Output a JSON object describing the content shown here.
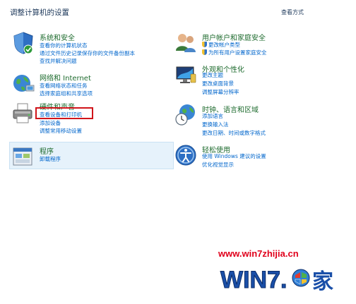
{
  "header": {
    "title": "调整计算机的设置",
    "view_by": "查看方式"
  },
  "categories": {
    "system_security": {
      "title": "系统和安全",
      "links": [
        "查看你的计算机状态",
        "通过文件历史记录保存你的文件备份副本",
        "查找并解决问题"
      ]
    },
    "network": {
      "title": "网络和 Internet",
      "links": [
        "查看网络状态和任务",
        "选择家庭组和共享选项"
      ]
    },
    "hardware": {
      "title": "硬件和声音",
      "links": [
        "查看设备和打印机",
        "添加设备",
        "调整常用移动设置"
      ]
    },
    "programs": {
      "title": "程序",
      "links": [
        "卸载程序"
      ]
    },
    "user_accounts": {
      "title": "用户帐户和家庭安全",
      "links": [
        "更改帐户类型",
        "为所有用户设置家庭安全"
      ]
    },
    "appearance": {
      "title": "外观和个性化",
      "links": [
        "更改主题",
        "更改桌面背景",
        "调整屏幕分辨率"
      ]
    },
    "clock_region": {
      "title": "时钟、语言和区域",
      "links": [
        "添加语言",
        "更换输入法",
        "更改日期、时间或数字格式"
      ]
    },
    "ease_access": {
      "title": "轻松使用",
      "links": [
        "使用 Windows 建议的设置",
        "优化视觉显示"
      ]
    }
  },
  "watermark": {
    "url": "www.win7zhijia.cn",
    "logo_text": "WIN7.",
    "logo_char": "家"
  }
}
